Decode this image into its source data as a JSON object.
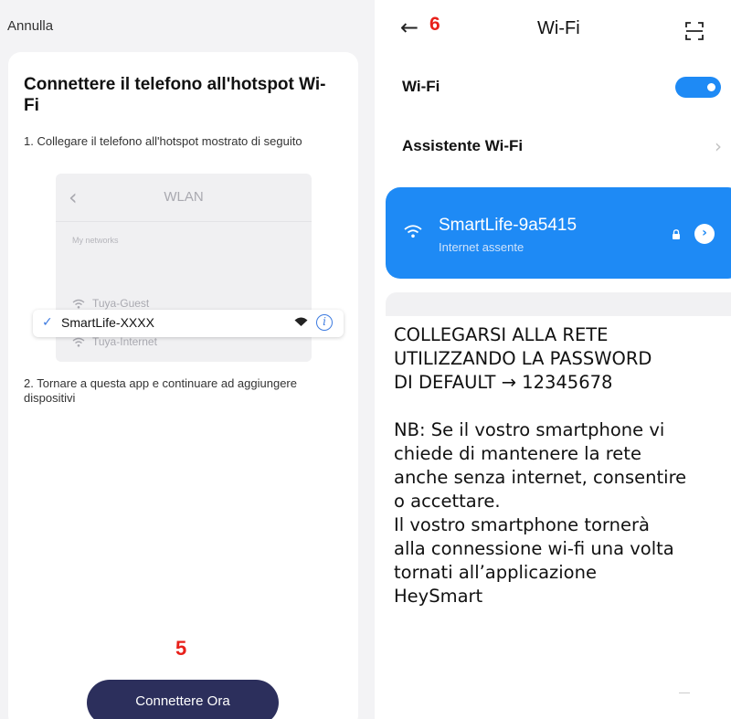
{
  "left_screen": {
    "cancel_label": "Annulla",
    "title": "Connettere il telefono all'hotspot Wi-Fi",
    "step1": "1. Collegare il telefono all'hotspot mostrato di seguito",
    "illustration": {
      "header_title": "WLAN",
      "back_icon": "chevron-left-icon",
      "section_label": "My networks",
      "selected_network": "SmartLife-XXXX",
      "other_networks": [
        "Tuya-Guest",
        "Tuya-Internet"
      ]
    },
    "step2": "2. Tornare a questa app e continuare ad aggiungere dispositivi",
    "step_marker": "5",
    "connect_button": "Connettere Ora",
    "button_color": "#2c2f5c"
  },
  "right_screen": {
    "step_marker": "6",
    "header_title": "Wi-Fi",
    "wifi_label": "Wi-Fi",
    "wifi_enabled": true,
    "assistant_label": "Assistente Wi-Fi",
    "connected_network": {
      "name": "SmartLife-9a5415",
      "status": "Internet assente",
      "color": "#1e8af5"
    },
    "instructions": {
      "line1": "COLLEGARSI ALLA RETE",
      "line2": "UTILIZZANDO LA PASSWORD",
      "line3": "DI DEFAULT  → 12345678",
      "note_lines": [
        "NB: Se il vostro smartphone vi",
        "chiede di mantenere la rete",
        "anche senza internet, consentire",
        "o accettare.",
        "Il vostro smartphone tornerà",
        "alla connessione wi-fi una volta",
        "tornati all’applicazione",
        "HeySmart"
      ]
    }
  },
  "colors": {
    "marker_red": "#e8201a",
    "accent_blue": "#1e8af5"
  }
}
